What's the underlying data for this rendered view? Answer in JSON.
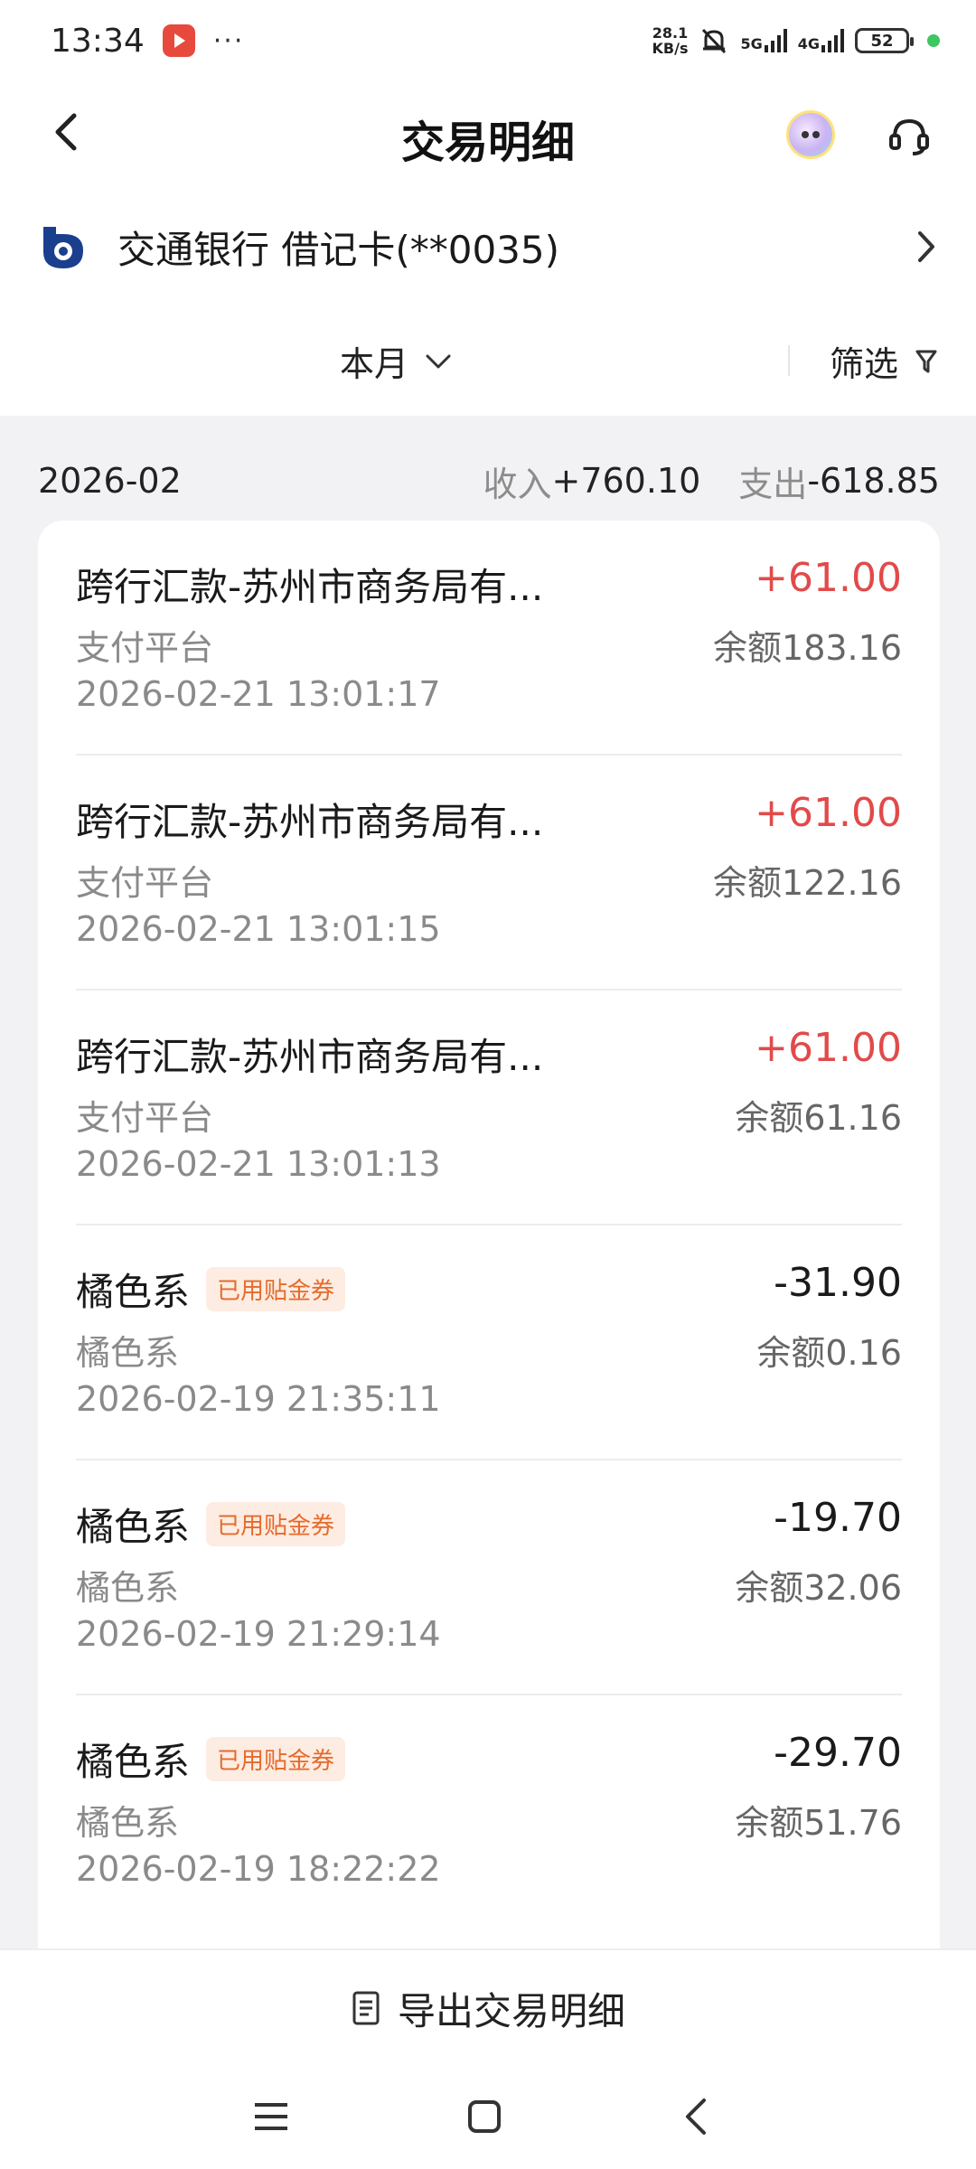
{
  "status_bar": {
    "time": "13:34",
    "dots": "···",
    "net_speed_value": "28.1",
    "net_speed_unit": "KB/s",
    "sig1": "5G",
    "sig2": "4G",
    "battery": "52"
  },
  "header": {
    "title": "交易明细"
  },
  "account": {
    "name": "交通银行 借记卡(**0035)"
  },
  "filter": {
    "month": "本月",
    "filter_label": "筛选"
  },
  "summary": {
    "month": "2026-02",
    "income_label": "收入",
    "income_value": "+760.10",
    "expense_label": "支出",
    "expense_value": "-618.85"
  },
  "transactions": [
    {
      "title": "跨行汇款-苏州市商务局有...",
      "tag": "",
      "amount": "+61.00",
      "type": "income",
      "sub": "支付平台",
      "balance": "余额183.16",
      "time": "2026-02-21 13:01:17"
    },
    {
      "title": "跨行汇款-苏州市商务局有...",
      "tag": "",
      "amount": "+61.00",
      "type": "income",
      "sub": "支付平台",
      "balance": "余额122.16",
      "time": "2026-02-21 13:01:15"
    },
    {
      "title": "跨行汇款-苏州市商务局有...",
      "tag": "",
      "amount": "+61.00",
      "type": "income",
      "sub": "支付平台",
      "balance": "余额61.16",
      "time": "2026-02-21 13:01:13"
    },
    {
      "title": "橘色系",
      "tag": "已用贴金券",
      "amount": "-31.90",
      "type": "expense",
      "sub": "橘色系",
      "balance": "余额0.16",
      "time": "2026-02-19 21:35:11"
    },
    {
      "title": "橘色系",
      "tag": "已用贴金券",
      "amount": "-19.70",
      "type": "expense",
      "sub": "橘色系",
      "balance": "余额32.06",
      "time": "2026-02-19 21:29:14"
    },
    {
      "title": "橘色系",
      "tag": "已用贴金券",
      "amount": "-29.70",
      "type": "expense",
      "sub": "橘色系",
      "balance": "余额51.76",
      "time": "2026-02-19 18:22:22"
    }
  ],
  "export": {
    "label": "导出交易明细"
  },
  "colors": {
    "income": "#e24a4a",
    "tag_text": "#e66a2c",
    "tag_bg": "#fdece1",
    "bank_logo": "#1b3f8f"
  }
}
